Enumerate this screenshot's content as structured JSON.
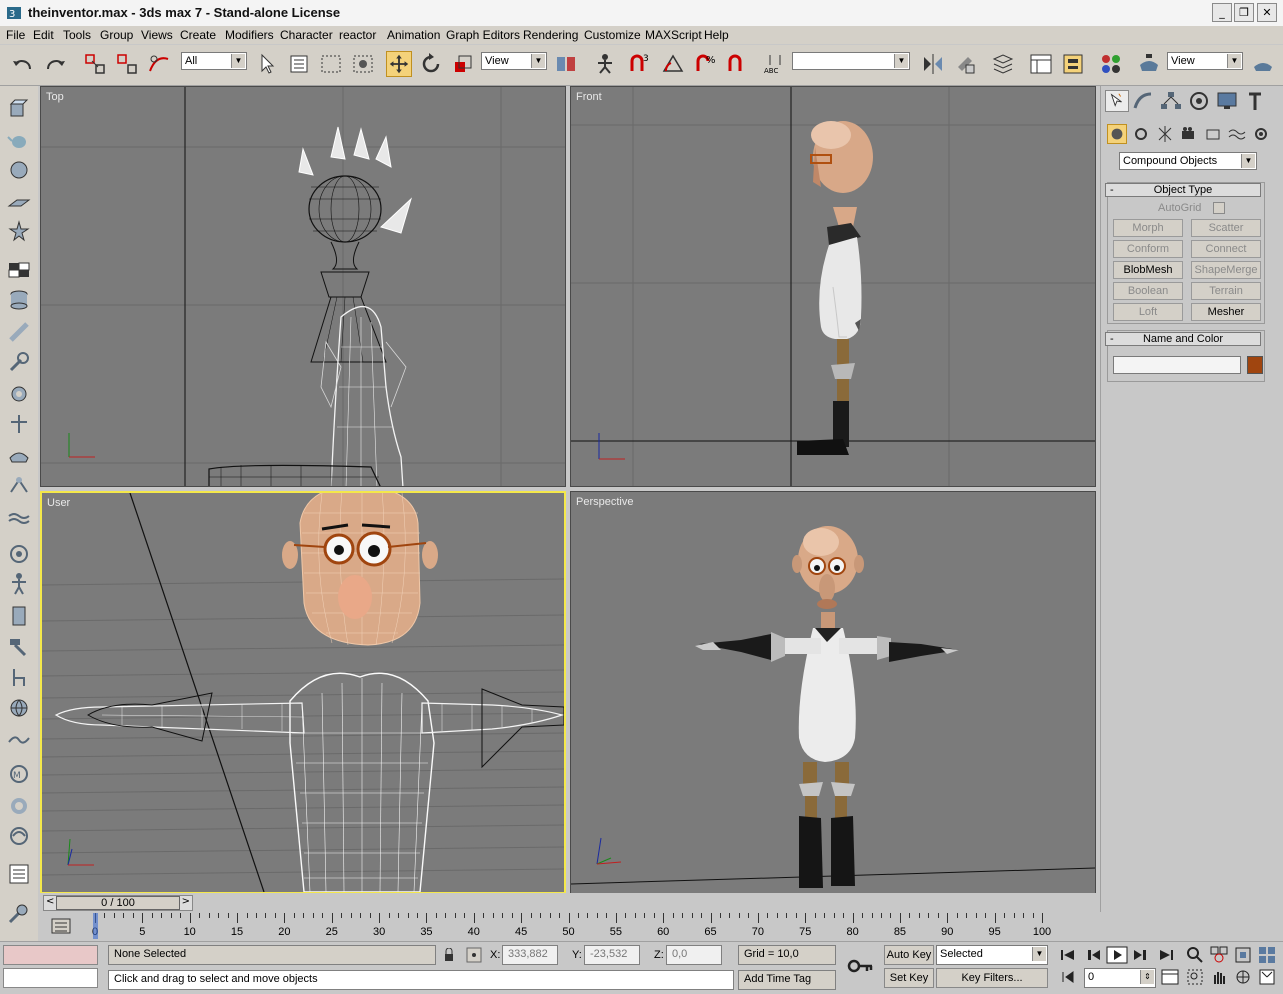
{
  "window": {
    "title": "theinventor.max - 3ds max 7 - Stand-alone License",
    "minimize": "_",
    "restore": "❐",
    "close": "✕"
  },
  "menu": [
    "File",
    "Edit",
    "Tools",
    "Group",
    "Views",
    "Create",
    "Modifiers",
    "Character",
    "reactor",
    "Animation",
    "Graph Editors",
    "Rendering",
    "Customize",
    "MAXScript",
    "Help"
  ],
  "toolbar": {
    "selection_filter": "All",
    "reference_coord": "View",
    "named_selection": "",
    "render_view": "View"
  },
  "viewports": {
    "top_label": "Top",
    "front_label": "Front",
    "user_label": "User",
    "perspective_label": "Perspective"
  },
  "command_panel": {
    "category": "Compound Objects",
    "object_type_title": "Object Type",
    "autogrid_label": "AutoGrid",
    "buttons": [
      {
        "label": "Morph",
        "enabled": false
      },
      {
        "label": "Scatter",
        "enabled": false
      },
      {
        "label": "Conform",
        "enabled": false
      },
      {
        "label": "Connect",
        "enabled": false
      },
      {
        "label": "BlobMesh",
        "enabled": true
      },
      {
        "label": "ShapeMerge",
        "enabled": false
      },
      {
        "label": "Boolean",
        "enabled": false
      },
      {
        "label": "Terrain",
        "enabled": false
      },
      {
        "label": "Loft",
        "enabled": false
      },
      {
        "label": "Mesher",
        "enabled": true
      }
    ],
    "name_color_title": "Name and Color",
    "name_value": "",
    "object_color": "#a0450f"
  },
  "timeline": {
    "slider_text": "0 / 100",
    "prev": "<",
    "next": ">",
    "ticks": [
      0,
      5,
      10,
      15,
      20,
      25,
      30,
      35,
      40,
      45,
      50,
      55,
      60,
      65,
      70,
      75,
      80,
      85,
      90,
      95,
      100
    ]
  },
  "status": {
    "selection": "None Selected",
    "prompt": "Click and drag to select and move objects",
    "x_label": "X:",
    "x_value": "333,882",
    "y_label": "Y:",
    "y_value": "-23,532",
    "z_label": "Z:",
    "z_value": "0,0",
    "grid": "Grid = 10,0",
    "add_time_tag": "Add Time Tag",
    "auto_key": "Auto Key",
    "set_key": "Set Key",
    "key_mode": "Selected",
    "key_filters": "Key Filters...",
    "frame": "0"
  }
}
